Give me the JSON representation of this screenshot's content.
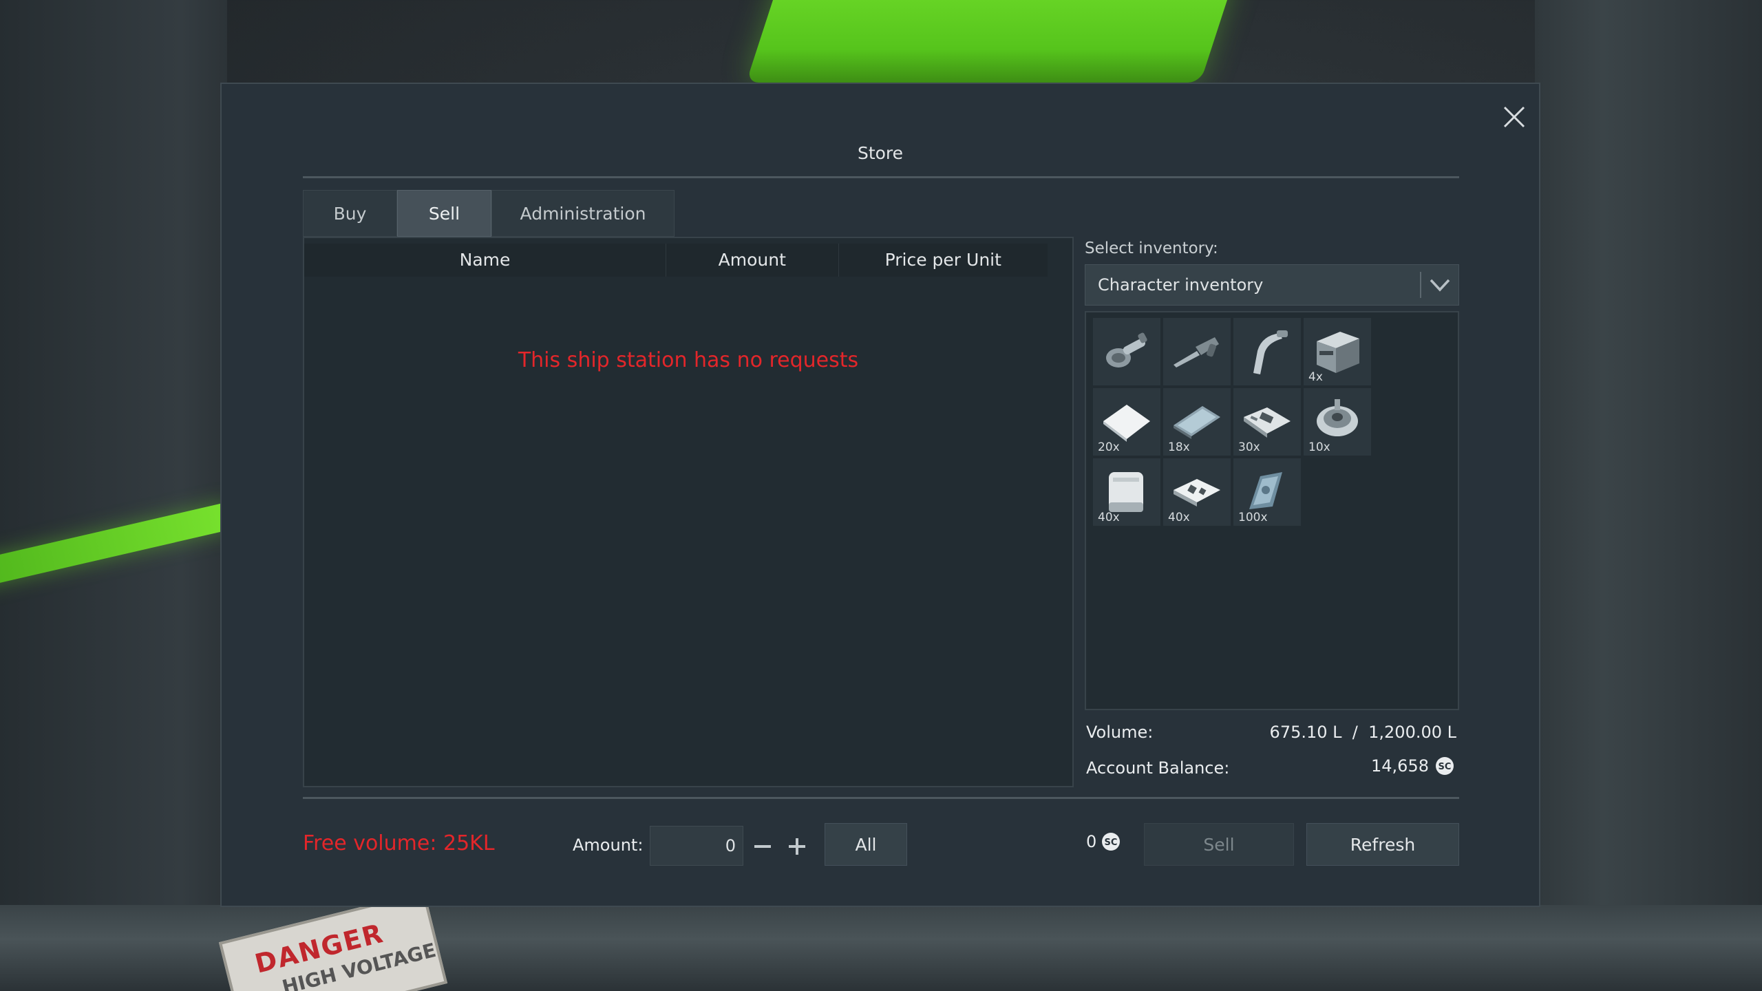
{
  "window": {
    "title": "Store"
  },
  "tabs": [
    {
      "label": "Buy",
      "active": false
    },
    {
      "label": "Sell",
      "active": true
    },
    {
      "label": "Administration",
      "active": false
    }
  ],
  "table": {
    "columns": [
      "Name",
      "Amount",
      "Price per Unit"
    ],
    "empty_message": "This ship station has no requests"
  },
  "inventory": {
    "select_label": "Select inventory:",
    "selected": "Character inventory",
    "items": [
      {
        "icon": "angle-grinder-icon",
        "qty": ""
      },
      {
        "icon": "hand-drill-icon",
        "qty": ""
      },
      {
        "icon": "welder-icon",
        "qty": ""
      },
      {
        "icon": "component-crate-icon",
        "qty": "4x"
      },
      {
        "icon": "steel-plate-icon",
        "qty": "20x"
      },
      {
        "icon": "glass-panel-icon",
        "qty": "18x"
      },
      {
        "icon": "computer-component-icon",
        "qty": "30x"
      },
      {
        "icon": "motor-icon",
        "qty": "10x"
      },
      {
        "icon": "large-container-icon",
        "qty": "40x"
      },
      {
        "icon": "construction-component-icon",
        "qty": "40x"
      },
      {
        "icon": "display-component-icon",
        "qty": "100x"
      }
    ],
    "volume_label": "Volume:",
    "volume_value": "675.10 L  /  1,200.00 L",
    "balance_label": "Account Balance:",
    "balance_value": "14,658"
  },
  "bottom": {
    "free_volume": "Free volume: 25KL",
    "amount_label": "Amount:",
    "amount_value": "0",
    "all_label": "All",
    "price_total": "0",
    "sell_label": "Sell",
    "refresh_label": "Refresh"
  },
  "background": {
    "sign_text": "DANGER",
    "sign_text2": "HIGH VOLTAGE"
  },
  "colors": {
    "accent_green": "#6fdc2a",
    "warning_red": "#e3262a",
    "panel": "#28323a"
  }
}
